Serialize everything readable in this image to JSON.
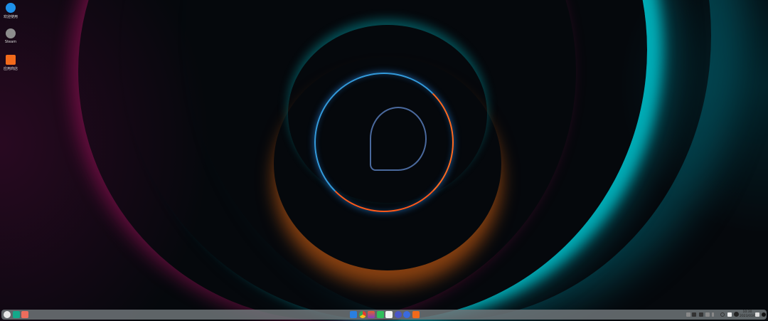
{
  "desktop": {
    "icons": [
      {
        "label": "欢迎使用",
        "icon": "welcome-icon",
        "color": "#1e90e8"
      },
      {
        "label": "Steam",
        "icon": "steam-icon",
        "color": "#9a9a9a"
      },
      {
        "label": "应用商店",
        "icon": "app-store-icon",
        "color": "#f26a1b"
      }
    ]
  },
  "taskbar": {
    "left": [
      {
        "icon": "launcher-icon"
      },
      {
        "icon": "multitask-view-icon"
      },
      {
        "icon": "workspace-icon"
      }
    ],
    "apps": [
      {
        "icon": "file-manager-icon",
        "color": "#2a7fe0"
      },
      {
        "icon": "chrome-icon",
        "color": "#e33b2e"
      },
      {
        "icon": "image-viewer-icon",
        "color": "#e06030"
      },
      {
        "icon": "music-icon",
        "color": "#2fbf5a"
      },
      {
        "icon": "text-editor-icon",
        "color": "#f2f2f2"
      },
      {
        "icon": "settings-icon",
        "color": "#4a55c8"
      },
      {
        "icon": "browser-icon",
        "color": "#3a6be0"
      },
      {
        "icon": "app-store-icon",
        "color": "#f26a1b"
      }
    ],
    "clock": {
      "time": "10:30",
      "date": "2023/03/01"
    }
  }
}
